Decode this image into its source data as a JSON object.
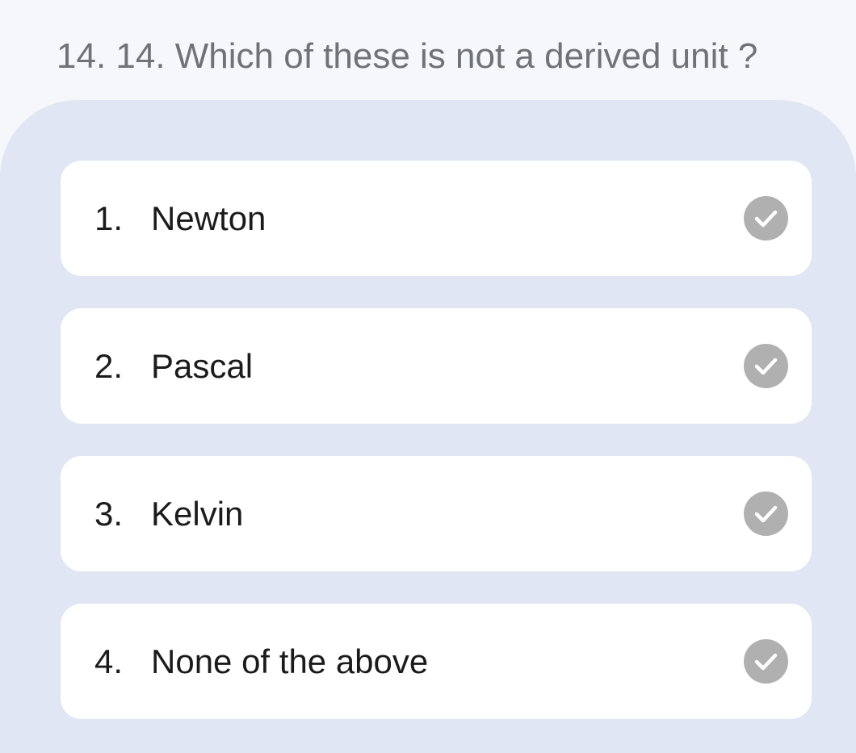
{
  "question": {
    "text": "14. 14. Which of these is not a derived unit ?"
  },
  "options": [
    {
      "number": "1.",
      "label": "Newton",
      "icon": "check-circle-icon"
    },
    {
      "number": "2.",
      "label": "Pascal",
      "icon": "check-circle-icon"
    },
    {
      "number": "3.",
      "label": "Kelvin",
      "icon": "check-circle-icon"
    },
    {
      "number": "4.",
      "label": "None of the above",
      "icon": "check-circle-icon"
    }
  ],
  "colors": {
    "page_background": "#f5f7fa",
    "panel_background": "#e0e6f3",
    "option_background": "#ffffff",
    "question_text": "#6f7276",
    "option_text": "#1b1b1b",
    "check_icon": "#b0b0b0"
  }
}
